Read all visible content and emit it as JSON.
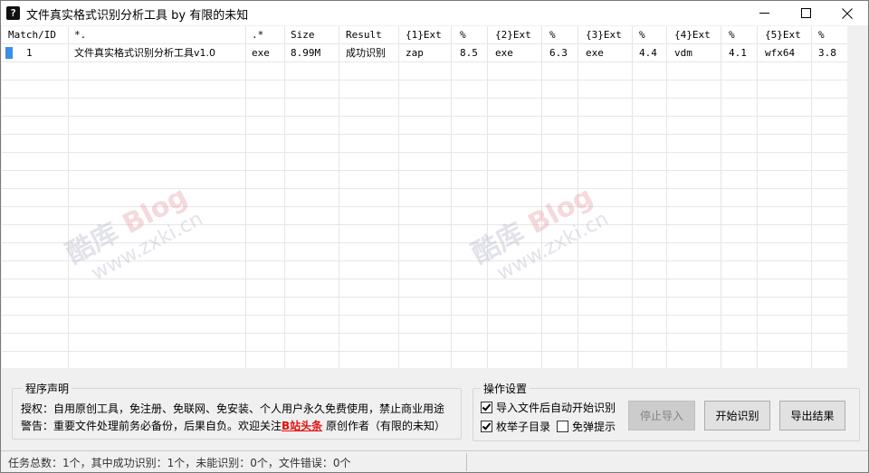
{
  "window": {
    "icon_glyph": "?",
    "title": "文件真实格式识别分析工具 by 有限的未知"
  },
  "table": {
    "columns": [
      "Match/ID",
      "*.",
      ".*",
      "Size",
      "Result",
      "{1}Ext",
      "%",
      "{2}Ext",
      "%",
      "{3}Ext",
      "%",
      "{4}Ext",
      "%",
      "{5}Ext",
      "%"
    ],
    "rows": [
      [
        "1",
        "文件真实格式识别分析工具v1.0",
        "exe",
        "8.99M",
        "成功识别",
        "zap",
        "8.5",
        "exe",
        "6.3",
        "exe",
        "4.4",
        "vdm",
        "4.1",
        "wfx64",
        "3.8"
      ]
    ]
  },
  "watermark": {
    "title": "酷库",
    "title_blog": "Blog",
    "url": "www.zxki.cn"
  },
  "notice": {
    "title": "程序声明",
    "line1": "授权：自用原创工具，免注册、免联网、免安装、个人用户永久免费使用，禁止商业用途",
    "line2_prefix": "警告：重要文件处理前务必备份，后果自负。欢迎关注",
    "line2_link": "B站头条",
    "line2_suffix": "原创作者（有限的未知）"
  },
  "settings": {
    "title": "操作设置",
    "auto_start": {
      "label": "导入文件后自动开始识别",
      "checked": true
    },
    "enum_subdirs": {
      "label": "枚举子目录",
      "checked": true
    },
    "no_popup": {
      "label": "免弹提示",
      "checked": false
    },
    "stop_import": "停止导入",
    "start_recognize": "开始识别",
    "export_results": "导出结果"
  },
  "status": {
    "text": "任务总数：1个，其中成功识别：1个，未能识别：0个，文件错误：0个"
  },
  "colors": {
    "row_marker": "#3c8ee8",
    "link_red": "#e01010",
    "grid_line": "#e6e6e6"
  }
}
